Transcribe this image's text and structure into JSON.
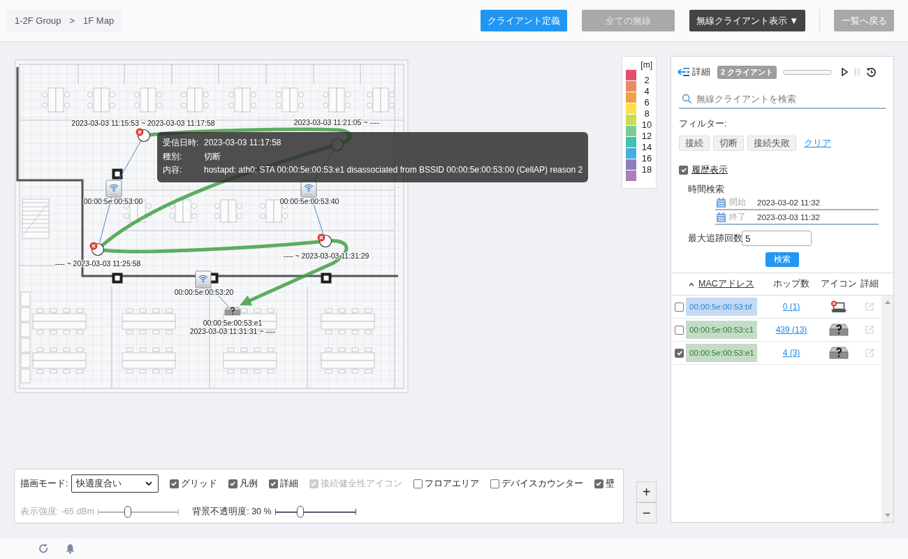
{
  "breadcrumb": {
    "items": [
      "1-2F Group",
      "1F Map"
    ],
    "separator": ">"
  },
  "header_buttons": [
    {
      "label": "クライアント定義",
      "kind": "primary",
      "disabled": false
    },
    {
      "label": "全ての無線",
      "kind": "secondary",
      "disabled": true
    },
    {
      "label": "無線クライアント表示 ▼",
      "kind": "dark",
      "disabled": false
    },
    {
      "label": "一覧へ戻る",
      "kind": "secondary",
      "disabled": false
    }
  ],
  "map": {
    "access_points": [
      {
        "mac": "00:00:5e:00:53:00"
      },
      {
        "mac": "00:00:5e:00:53:40"
      },
      {
        "mac": "00:00:5e:00:53:20"
      }
    ],
    "track": [
      {
        "time": "2023-03-03 11:15:53 ~ 2023-03-03 11:17:58",
        "disconnected": true
      },
      {
        "time": "2023-03-03 11:21:05 ~ ----",
        "disconnected": false
      },
      {
        "time": "---- ~ 2023-03-03 11:25:58",
        "disconnected": true
      },
      {
        "time": "---- ~ 2023-03-03 11:31:29",
        "disconnected": true
      }
    ],
    "client": {
      "mac": "00:00:5e:00:53:e1",
      "time": "2023-03-03 11:31:31 ~ ----"
    },
    "tooltip": [
      {
        "label": "受信日時:",
        "value": "2023-03-03 11:17:58"
      },
      {
        "label": "種別:",
        "value": "切断"
      },
      {
        "label": "内容:",
        "value": "hostapd: ath0: STA 00:00:5e:00:53:e1 disassociated from BSSID 00:00:5e:00:53:00 (CellAP) reason 2"
      }
    ]
  },
  "legend": {
    "unit": "[m]",
    "swatches": [
      {
        "color": "#e94b6c"
      },
      {
        "color": "#ec8866"
      },
      {
        "color": "#f0a24a"
      },
      {
        "color": "#fddf4b"
      },
      {
        "color": "#cbdd4f"
      },
      {
        "color": "#7ccb95"
      },
      {
        "color": "#45bfb1"
      },
      {
        "color": "#45ade2"
      },
      {
        "color": "#8e80bd"
      },
      {
        "color": "#ab80b9"
      }
    ],
    "labels": [
      "2",
      "4",
      "6",
      "8",
      "10",
      "12",
      "14",
      "16",
      "18"
    ]
  },
  "display_options": {
    "mode_label": "描画モード:",
    "mode_value": "快適度合い",
    "checkboxes": [
      {
        "label": "グリッド",
        "checked": true,
        "disabled": false
      },
      {
        "label": "凡例",
        "checked": true,
        "disabled": false
      },
      {
        "label": "詳細",
        "checked": true,
        "disabled": false
      },
      {
        "label": "接続健全性アイコン",
        "checked": true,
        "disabled": true
      },
      {
        "label": "フロアエリア",
        "checked": false,
        "disabled": false
      },
      {
        "label": "デバイスカウンター",
        "checked": false,
        "disabled": false
      },
      {
        "label": "壁",
        "checked": true,
        "disabled": false
      }
    ],
    "sliders": [
      {
        "label": "表示強度: -65 dBm",
        "level": 0.37,
        "disabled": true
      },
      {
        "label": "背景不透明度: 30 %",
        "level": 0.31,
        "disabled": false
      }
    ]
  },
  "zoom_buttons": [
    "+",
    "−"
  ],
  "panel": {
    "title": "詳細",
    "client_count": "2 クライアント",
    "playback": {
      "pause_disabled": true
    },
    "search": {
      "placeholder": "無線クライアントを検索"
    },
    "filter": {
      "label": "フィルター:",
      "buttons": [
        {
          "label": "接続",
          "selected": false
        },
        {
          "label": "切断",
          "selected": false
        },
        {
          "label": "接続失敗",
          "selected": false
        }
      ],
      "clear": "クリア"
    },
    "history": {
      "label": "履歴表示",
      "checked": true
    },
    "time_search": {
      "label": "時間検索",
      "fields": [
        {
          "label": "開始",
          "value": "2023-03-02 11:32"
        },
        {
          "label": "終了",
          "value": "2023-03-03 11:32"
        }
      ]
    },
    "max_trace": {
      "label": "最大追跡回数",
      "value": "5"
    },
    "search_button": "検索",
    "table": {
      "columns": [
        {
          "label": "MACアドレス",
          "sorted": true
        },
        {
          "label": "ホップ数",
          "sorted": false
        },
        {
          "label": "アイコン",
          "sorted": false
        },
        {
          "label": "詳細",
          "sorted": false
        }
      ],
      "rows": [
        {
          "checked": false,
          "mac": "00:00:5e:00:53:bf",
          "color": "#2b7fd4",
          "hops": "0 (1)",
          "kind": "laptop"
        },
        {
          "checked": false,
          "mac": "00:00:5e:00:53:c1",
          "color": "#2e7d32",
          "hops": "439 (13)",
          "kind": "unknown"
        },
        {
          "checked": true,
          "mac": "00:00:5e:00:53:e1",
          "color": "#2e7d32",
          "hops": "4 (3)",
          "kind": "unknown"
        }
      ]
    }
  }
}
